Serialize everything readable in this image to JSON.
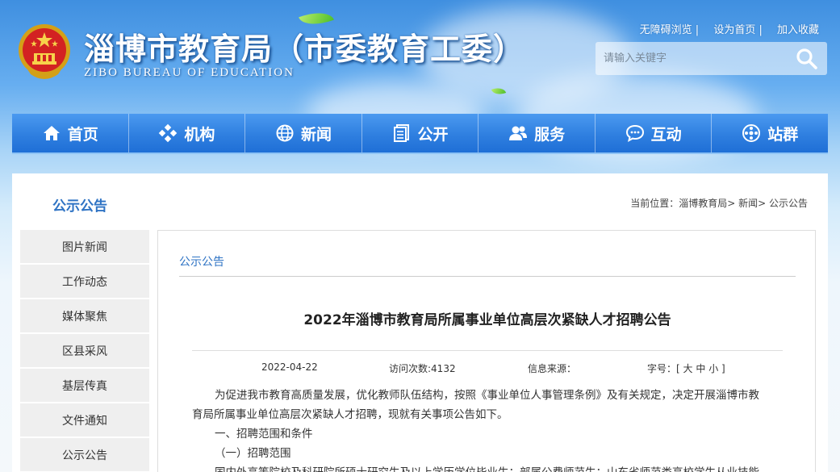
{
  "header": {
    "title": "淄博市教育局（市委教育工委）",
    "subtitle": "ZIBO BUREAU OF EDUCATION",
    "top_links": [
      "无障碍浏览 |",
      "设为首页 |",
      "加入收藏"
    ],
    "search_placeholder": "请输入关键字"
  },
  "nav": [
    {
      "label": "首页",
      "icon": "home-icon"
    },
    {
      "label": "机构",
      "icon": "org-icon"
    },
    {
      "label": "新闻",
      "icon": "globe-icon"
    },
    {
      "label": "公开",
      "icon": "document-icon"
    },
    {
      "label": "服务",
      "icon": "users-icon"
    },
    {
      "label": "互动",
      "icon": "chat-icon"
    },
    {
      "label": "站群",
      "icon": "site-group-icon"
    }
  ],
  "section": {
    "title": "公示公告",
    "breadcrumb_prefix": "当前位置：",
    "breadcrumb": [
      "淄博教育局",
      "新闻",
      "公示公告"
    ],
    "breadcrumb_sep": "> "
  },
  "sidebar": [
    "图片新闻",
    "工作动态",
    "媒体聚焦",
    "区县采风",
    "基层传真",
    "文件通知",
    "公示公告"
  ],
  "article": {
    "category": "公示公告",
    "title": "2022年淄博市教育局所属事业单位高层次紧缺人才招聘公告",
    "date": "2022-04-22",
    "visits": "访问次数:4132",
    "source": "信息来源：",
    "font_size_label": "字号：[",
    "font_large": "大",
    "font_medium": "中",
    "font_small": "小",
    "font_close": "]",
    "paragraphs": [
      "为促进我市教育高质量发展，优化教师队伍结构，按照《事业单位人事管理条例》及有关规定，决定开展淄博市教",
      "育局所属事业单位高层次紧缺人才招聘，现就有关事项公告如下。",
      "一、招聘范围和条件",
      "（一）招聘范围",
      "国内外高等院校及科研院所硕士研究生及以上学历学位毕业生；部属公费师范生；山东省师范类高校学生从业技能"
    ]
  }
}
